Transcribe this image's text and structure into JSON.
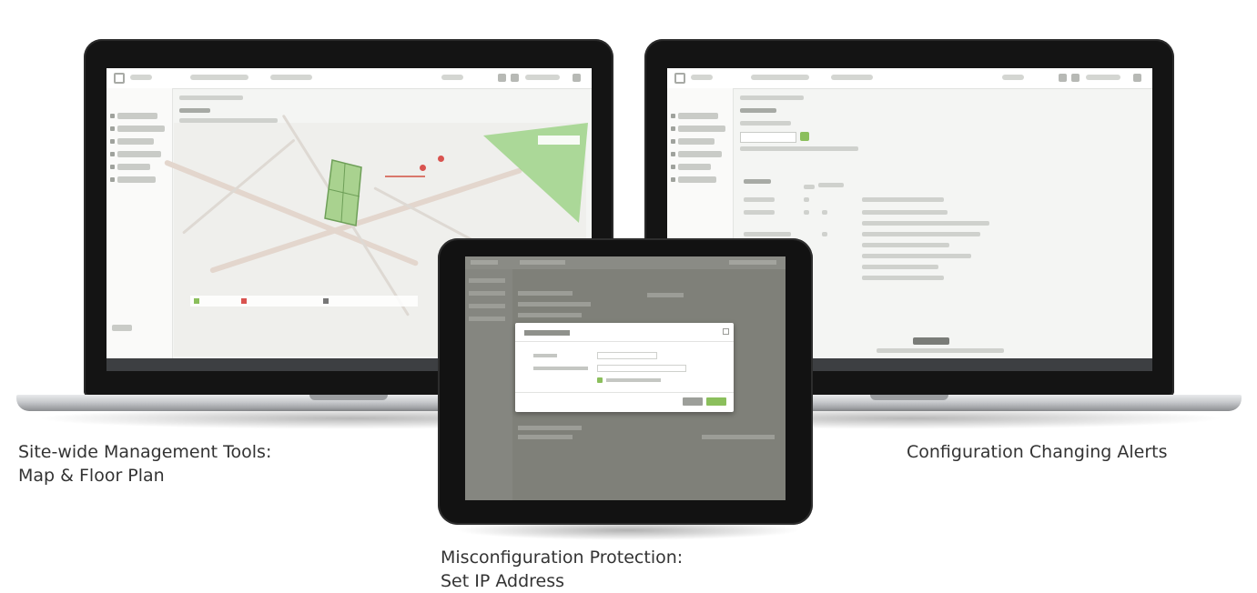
{
  "captions": {
    "left_line1": "Site-wide Management Tools:",
    "left_line2": "Map & Floor Plan",
    "right": "Configuration Changing Alerts",
    "center_line1": "Misconfiguration Protection:",
    "center_line2": "Set IP Address"
  },
  "devices": [
    {
      "name": "left-laptop",
      "screen": "map-floor-plan"
    },
    {
      "name": "right-laptop",
      "screen": "configuration-alerts"
    },
    {
      "name": "center-tablet",
      "screen": "set-ip-address-dialog"
    }
  ],
  "colors": {
    "accent_green": "#8bbf5c",
    "bezel": "#141414",
    "status_bar": "#3d3f42",
    "dialog_overlay": "#7f8079"
  }
}
